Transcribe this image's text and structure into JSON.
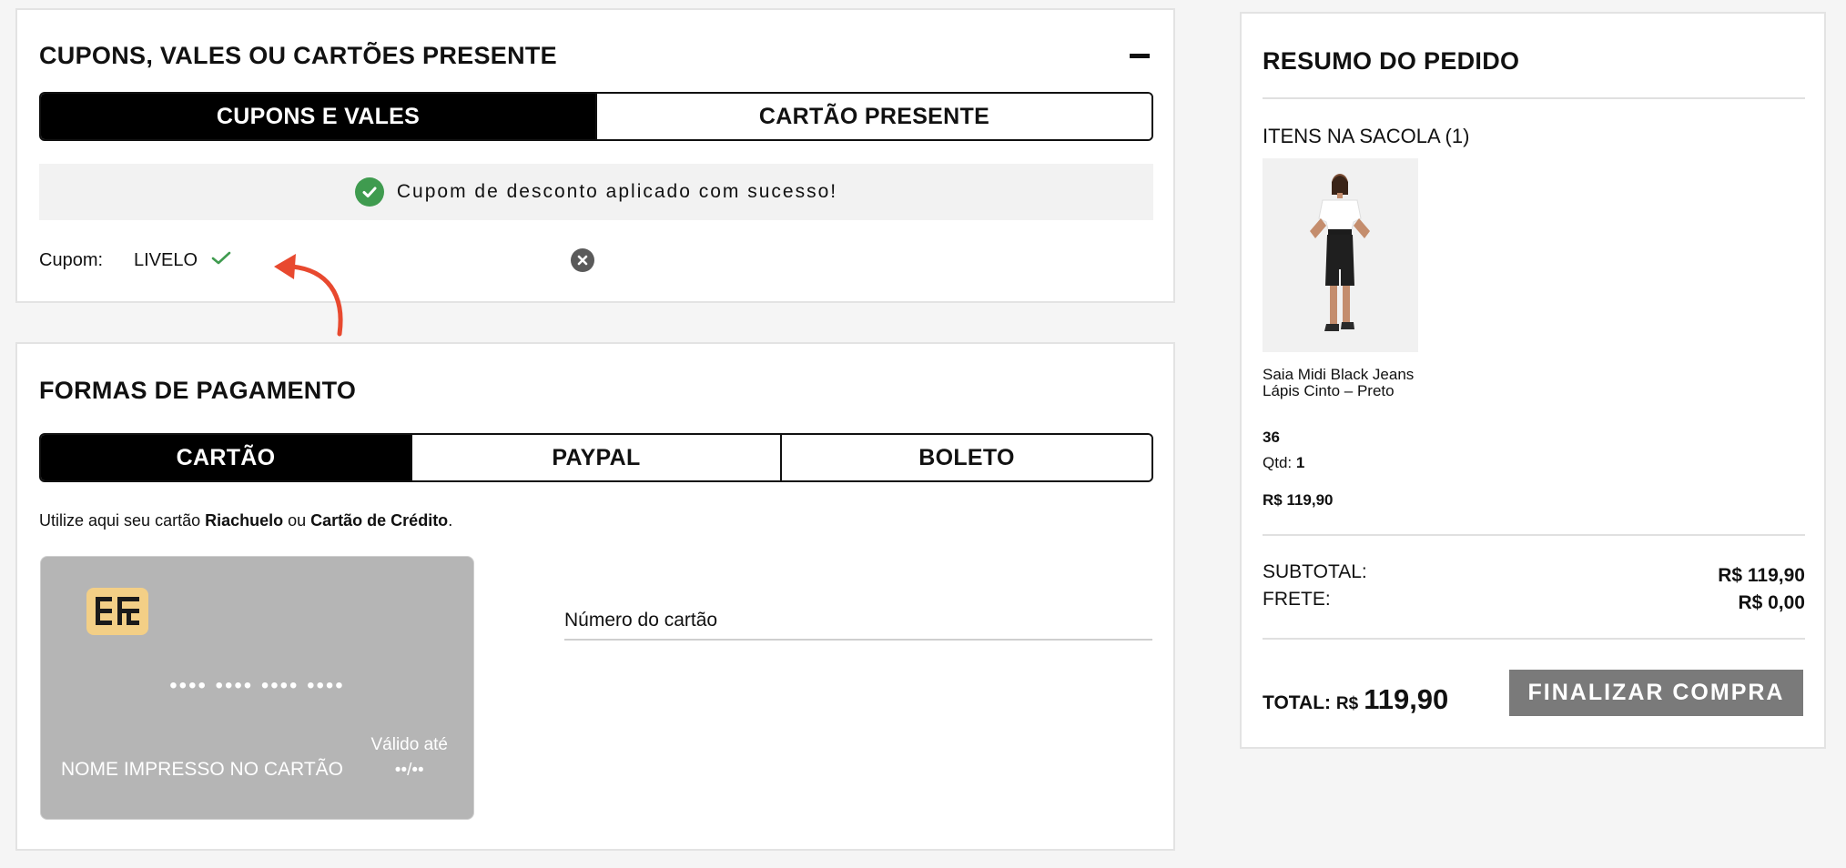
{
  "coupons": {
    "title": "CUPONS, VALES OU CARTÕES PRESENTE",
    "tabs": [
      {
        "label": "CUPONS E VALES",
        "active": true
      },
      {
        "label": "CARTÃO PRESENTE",
        "active": false
      }
    ],
    "success_message": "Cupom de desconto aplicado com sucesso!",
    "coupon_label": "Cupom:",
    "coupon_code": "LIVELO"
  },
  "payment": {
    "title": "FORMAS DE PAGAMENTO",
    "tabs": [
      {
        "label": "CARTÃO",
        "active": true
      },
      {
        "label": "PAYPAL",
        "active": false
      },
      {
        "label": "BOLETO",
        "active": false
      }
    ],
    "info_prefix": "Utilize aqui seu cartão ",
    "info_brand1": "Riachuelo",
    "info_mid": " ou ",
    "info_brand2": "Cartão de Crédito",
    "info_suffix": ".",
    "card": {
      "number_mask": "•••• •••• •••• ••••",
      "name_placeholder": "NOME IMPRESSO NO CARTÃO",
      "valid_label": "Válido até",
      "valid_mask": "••/••"
    },
    "card_number_placeholder": "Número do cartão"
  },
  "summary": {
    "title": "RESUMO DO PEDIDO",
    "items_title": "ITENS NA SACOLA (1)",
    "product": {
      "name": "Saia Midi Black Jeans Lápis Cinto – Preto",
      "size": "36",
      "qty_label": "Qtd:",
      "qty": "1",
      "price": "R$ 119,90"
    },
    "subtotal_label": "SUBTOTAL:",
    "subtotal_value": "R$ 119,90",
    "shipping_label": "FRETE:",
    "shipping_value": "R$ 0,00",
    "total_label": "TOTAL:",
    "total_currency": "R$",
    "total_value": "119,90",
    "finalize_label": "FINALIZAR COMPRA"
  },
  "colors": {
    "success_green": "#3f9b4f",
    "arrow_red": "#e8492f",
    "button_gray": "#7a7a7a",
    "card_gray": "#b5b5b5",
    "chip_gold": "#f3cf86"
  }
}
